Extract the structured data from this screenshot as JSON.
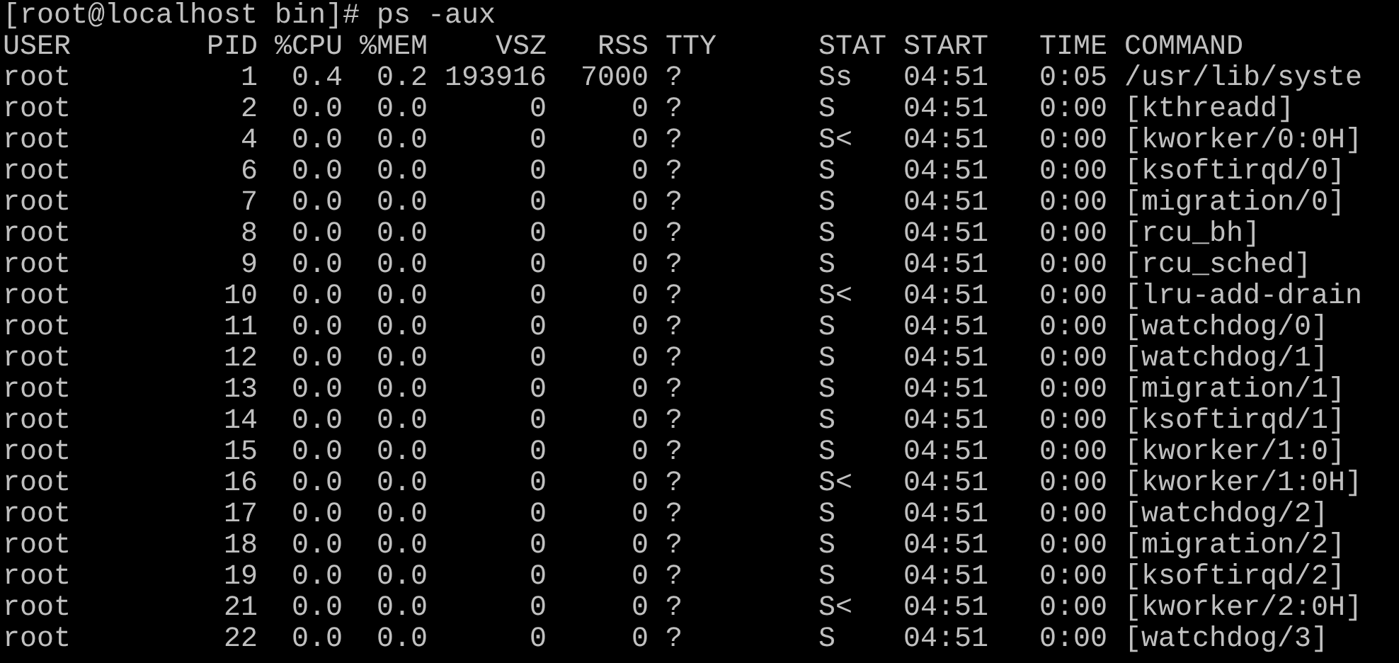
{
  "prompt": "[root@localhost bin]# ps -aux",
  "table": {
    "columns": [
      "USER",
      "PID",
      "%CPU",
      "%MEM",
      "VSZ",
      "RSS",
      "TTY",
      "STAT",
      "START",
      "TIME",
      "COMMAND"
    ],
    "rows": [
      [
        "root",
        "1",
        "0.4",
        "0.2",
        "193916",
        "7000",
        "?",
        "Ss",
        "04:51",
        "0:05",
        "/usr/lib/syste"
      ],
      [
        "root",
        "2",
        "0.0",
        "0.0",
        "0",
        "0",
        "?",
        "S",
        "04:51",
        "0:00",
        "[kthreadd]"
      ],
      [
        "root",
        "4",
        "0.0",
        "0.0",
        "0",
        "0",
        "?",
        "S<",
        "04:51",
        "0:00",
        "[kworker/0:0H]"
      ],
      [
        "root",
        "6",
        "0.0",
        "0.0",
        "0",
        "0",
        "?",
        "S",
        "04:51",
        "0:00",
        "[ksoftirqd/0]"
      ],
      [
        "root",
        "7",
        "0.0",
        "0.0",
        "0",
        "0",
        "?",
        "S",
        "04:51",
        "0:00",
        "[migration/0]"
      ],
      [
        "root",
        "8",
        "0.0",
        "0.0",
        "0",
        "0",
        "?",
        "S",
        "04:51",
        "0:00",
        "[rcu_bh]"
      ],
      [
        "root",
        "9",
        "0.0",
        "0.0",
        "0",
        "0",
        "?",
        "S",
        "04:51",
        "0:00",
        "[rcu_sched]"
      ],
      [
        "root",
        "10",
        "0.0",
        "0.0",
        "0",
        "0",
        "?",
        "S<",
        "04:51",
        "0:00",
        "[lru-add-drain"
      ],
      [
        "root",
        "11",
        "0.0",
        "0.0",
        "0",
        "0",
        "?",
        "S",
        "04:51",
        "0:00",
        "[watchdog/0]"
      ],
      [
        "root",
        "12",
        "0.0",
        "0.0",
        "0",
        "0",
        "?",
        "S",
        "04:51",
        "0:00",
        "[watchdog/1]"
      ],
      [
        "root",
        "13",
        "0.0",
        "0.0",
        "0",
        "0",
        "?",
        "S",
        "04:51",
        "0:00",
        "[migration/1]"
      ],
      [
        "root",
        "14",
        "0.0",
        "0.0",
        "0",
        "0",
        "?",
        "S",
        "04:51",
        "0:00",
        "[ksoftirqd/1]"
      ],
      [
        "root",
        "15",
        "0.0",
        "0.0",
        "0",
        "0",
        "?",
        "S",
        "04:51",
        "0:00",
        "[kworker/1:0]"
      ],
      [
        "root",
        "16",
        "0.0",
        "0.0",
        "0",
        "0",
        "?",
        "S<",
        "04:51",
        "0:00",
        "[kworker/1:0H]"
      ],
      [
        "root",
        "17",
        "0.0",
        "0.0",
        "0",
        "0",
        "?",
        "S",
        "04:51",
        "0:00",
        "[watchdog/2]"
      ],
      [
        "root",
        "18",
        "0.0",
        "0.0",
        "0",
        "0",
        "?",
        "S",
        "04:51",
        "0:00",
        "[migration/2]"
      ],
      [
        "root",
        "19",
        "0.0",
        "0.0",
        "0",
        "0",
        "?",
        "S",
        "04:51",
        "0:00",
        "[ksoftirqd/2]"
      ],
      [
        "root",
        "21",
        "0.0",
        "0.0",
        "0",
        "0",
        "?",
        "S<",
        "04:51",
        "0:00",
        "[kworker/2:0H]"
      ],
      [
        "root",
        "22",
        "0.0",
        "0.0",
        "0",
        "0",
        "?",
        "S",
        "04:51",
        "0:00",
        "[watchdog/3]"
      ]
    ]
  }
}
